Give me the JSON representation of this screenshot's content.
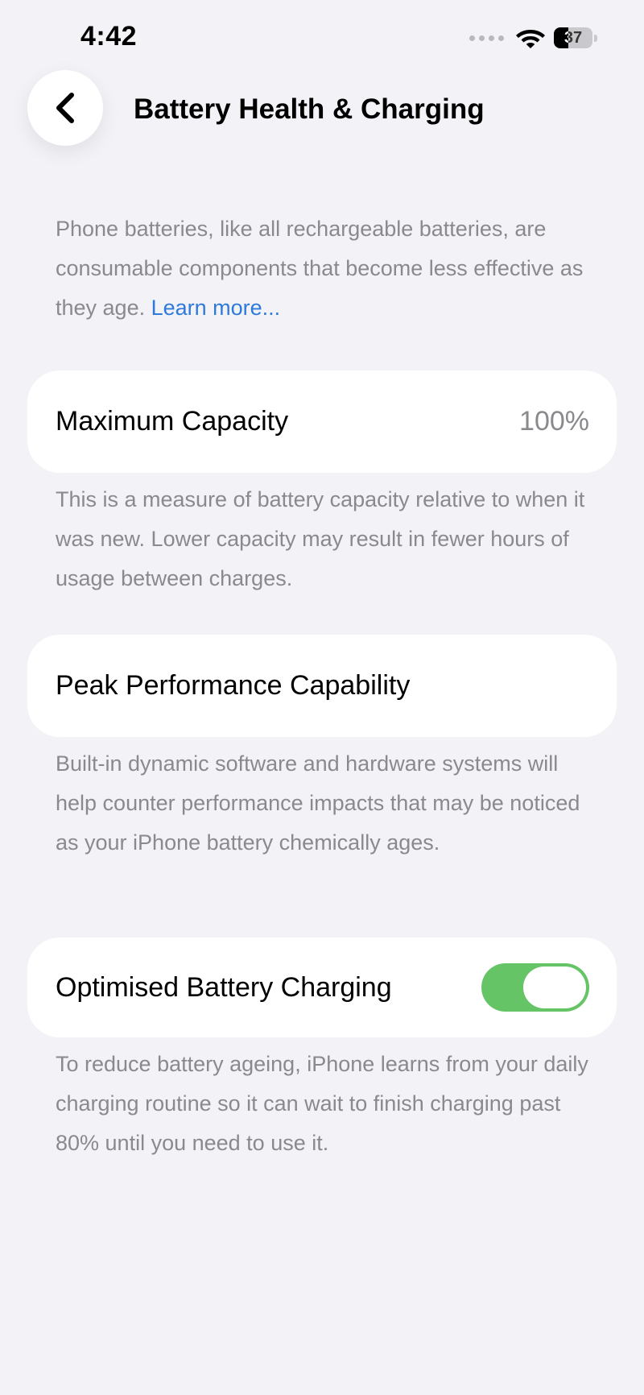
{
  "status_bar": {
    "time": "4:42",
    "battery_level": "37"
  },
  "nav": {
    "title": "Battery Health & Charging"
  },
  "intro": {
    "text": "Phone batteries, like all rechargeable batteries, are consumable components that become less effective as they age.",
    "link_label": "Learn more..."
  },
  "maximum_capacity": {
    "label": "Maximum Capacity",
    "value": "100%",
    "description": "This is a measure of battery capacity relative to when it was new. Lower capacity may result in fewer hours of usage between charges."
  },
  "peak_performance": {
    "label": "Peak Performance Capability",
    "description": "Built-in dynamic software and hardware systems will help counter performance impacts that may be noticed as your iPhone battery chemically ages."
  },
  "optimised_charging": {
    "label": "Optimised Battery Charging",
    "enabled": true,
    "description": "To reduce battery ageing, iPhone learns from your daily charging routine so it can wait to finish charging past 80% until you need to use it."
  },
  "colors": {
    "background": "#f2f2f7",
    "link": "#2f7ad9",
    "toggle_on": "#65c466",
    "secondary_text": "#8a8a8e"
  },
  "icons": {
    "back": "chevron-left-icon",
    "wifi": "wifi-icon",
    "battery": "battery-icon",
    "signal": "cellular-signal-icon"
  }
}
